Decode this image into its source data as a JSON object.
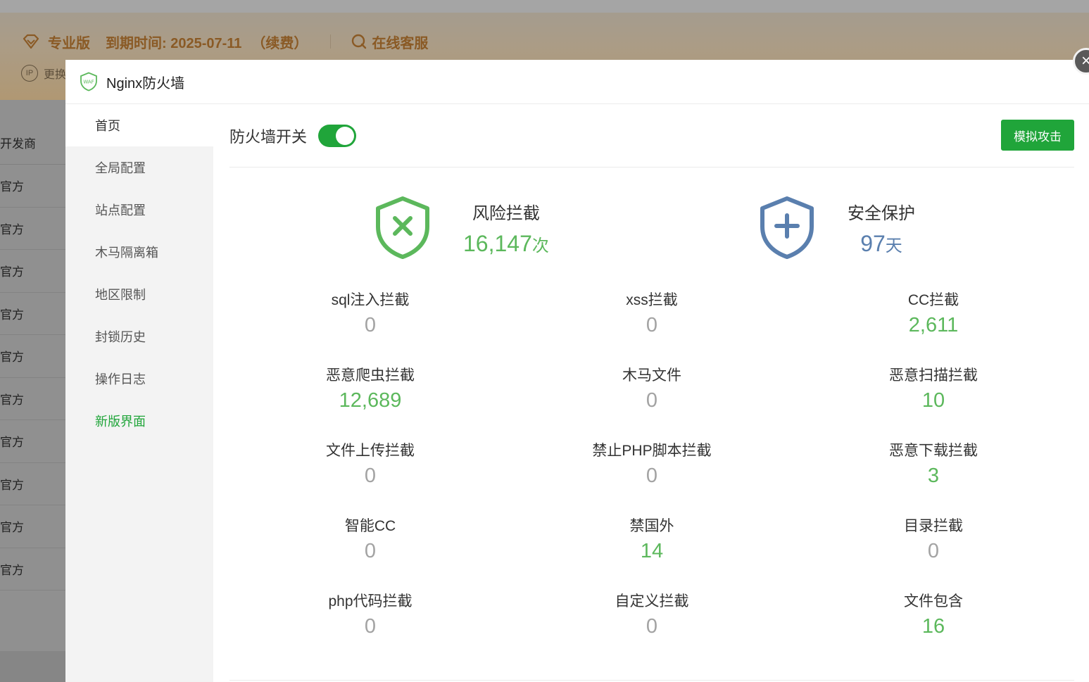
{
  "background": {
    "edition": "专业版",
    "expiry": "到期时间: 2025-07-11",
    "renew": "（续费）",
    "support": "在线客服",
    "ip_action": "更换",
    "list_header": "开发商",
    "list_rows": [
      "官方",
      "官方",
      "官方",
      "官方",
      "官方",
      "官方",
      "官方",
      "官方",
      "官方",
      "官方"
    ]
  },
  "modal": {
    "title": "Nginx防火墙",
    "logo_text": "WAF",
    "close": "×"
  },
  "sidebar": {
    "items": [
      {
        "label": "首页"
      },
      {
        "label": "全局配置"
      },
      {
        "label": "站点配置"
      },
      {
        "label": "木马隔离箱"
      },
      {
        "label": "地区限制"
      },
      {
        "label": "封锁历史"
      },
      {
        "label": "操作日志"
      },
      {
        "label": "新版界面"
      }
    ]
  },
  "toolbar": {
    "switch_label": "防火墙开关",
    "switch_on": true,
    "simulate_button": "模拟攻击"
  },
  "summary": {
    "risk": {
      "label": "风险拦截",
      "value": "16,147",
      "unit": "次"
    },
    "protect": {
      "label": "安全保护",
      "value": "97",
      "unit": "天"
    }
  },
  "stats": [
    {
      "label": "sql注入拦截",
      "value": "0"
    },
    {
      "label": "xss拦截",
      "value": "0"
    },
    {
      "label": "CC拦截",
      "value": "2,611"
    },
    {
      "label": "恶意爬虫拦截",
      "value": "12,689"
    },
    {
      "label": "木马文件",
      "value": "0"
    },
    {
      "label": "恶意扫描拦截",
      "value": "10"
    },
    {
      "label": "文件上传拦截",
      "value": "0"
    },
    {
      "label": "禁止PHP脚本拦截",
      "value": "0"
    },
    {
      "label": "恶意下载拦截",
      "value": "3"
    },
    {
      "label": "智能CC",
      "value": "0"
    },
    {
      "label": "禁国外",
      "value": "14"
    },
    {
      "label": "目录拦截",
      "value": "0"
    },
    {
      "label": "php代码拦截",
      "value": "0"
    },
    {
      "label": "自定义拦截",
      "value": "0"
    },
    {
      "label": "文件包含",
      "value": "16"
    }
  ],
  "colors": {
    "accent": "#20a53a",
    "positive_value": "#5cb85c",
    "zero_value": "#a3a3a3",
    "protect_blue": "#5a7fae"
  }
}
